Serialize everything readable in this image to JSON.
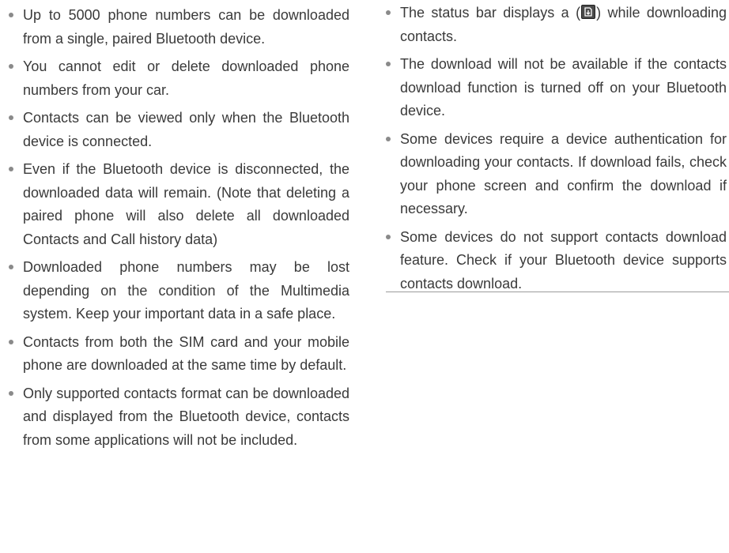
{
  "left_column": {
    "items": [
      "Up to 5000 phone numbers can be downloaded from a single, paired Bluetooth device.",
      "You cannot edit or delete downloaded phone numbers from your car.",
      "Contacts can be viewed only when the Bluetooth device is connected.",
      "Even if the Bluetooth device is disconnected, the downloaded data will remain. (Note that deleting a paired phone will also delete all downloaded Contacts and Call history data)",
      "Downloaded phone numbers may be lost depending on the condition of the Multimedia system. Keep your important data in a safe place.",
      "Contacts from both the SIM card and your mobile phone are downloaded at the same time by default.",
      "Only supported contacts format can be downloaded and displayed from the Bluetooth device, contacts from some applications will not be included."
    ]
  },
  "right_column": {
    "status_item": {
      "before_icon": "The status bar displays a (",
      "after_icon": ") while downloading contacts.",
      "icon": "contacts-download-status-icon"
    },
    "items": [
      "The download will not be available if the contacts download function is turned off on your Bluetooth device.",
      "Some devices require a device authentication for downloading your contacts. If download fails, check your phone screen and confirm the download if necessary.",
      "Some devices do not support contacts download feature. Check if your Bluetooth device supports contacts download."
    ]
  }
}
